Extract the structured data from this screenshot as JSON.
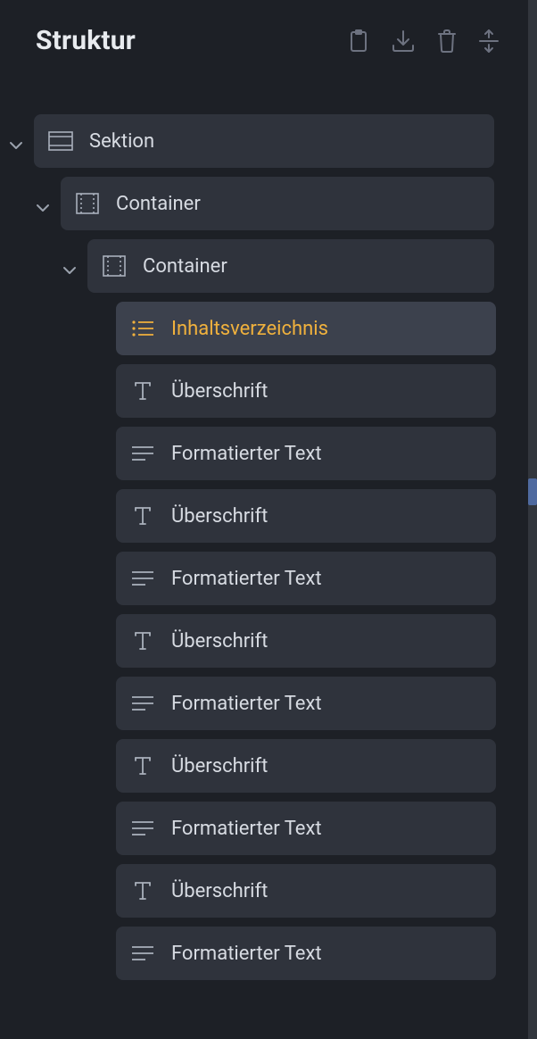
{
  "header": {
    "title": "Struktur"
  },
  "tree": {
    "section": {
      "label": "Sektion"
    },
    "container1": {
      "label": "Container"
    },
    "container2": {
      "label": "Container"
    },
    "items": [
      {
        "kind": "toc",
        "label": "Inhaltsverzeichnis",
        "selected": true
      },
      {
        "kind": "heading",
        "label": "Überschrift"
      },
      {
        "kind": "richtext",
        "label": "Formatierter Text"
      },
      {
        "kind": "heading",
        "label": "Überschrift"
      },
      {
        "kind": "richtext",
        "label": "Formatierter Text"
      },
      {
        "kind": "heading",
        "label": "Überschrift"
      },
      {
        "kind": "richtext",
        "label": "Formatierter Text"
      },
      {
        "kind": "heading",
        "label": "Überschrift"
      },
      {
        "kind": "richtext",
        "label": "Formatierter Text"
      },
      {
        "kind": "heading",
        "label": "Überschrift"
      },
      {
        "kind": "richtext",
        "label": "Formatierter Text"
      }
    ]
  }
}
